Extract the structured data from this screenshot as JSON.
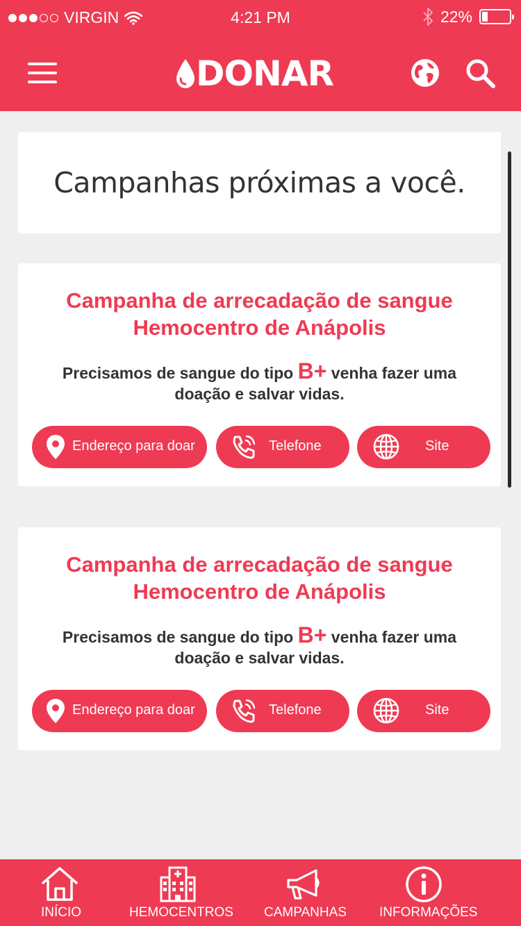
{
  "status_bar": {
    "carrier": "VIRGIN",
    "signal_bars": 3,
    "time": "4:21 PM",
    "battery_text": "22%",
    "battery_level": 0.22,
    "icons": [
      "signal-dots-icon",
      "wifi-icon",
      "bluetooth-icon",
      "battery-icon"
    ]
  },
  "navbar": {
    "logo_text": "DONAR",
    "icons": [
      "menu-icon",
      "blood-drop-icon",
      "globe-icon",
      "search-icon"
    ]
  },
  "header": {
    "title": "Campanhas próximas a você."
  },
  "campaigns": [
    {
      "title_line1": "Campanha de arrecadação de sangue",
      "title_line2": "Hemocentro de Anápolis",
      "desc_before": "Precisamos  de sangue do tipo ",
      "blood_type": "B+",
      "desc_after": " venha fazer uma",
      "desc_line2": "doação e salvar vidas.",
      "buttons": {
        "address": "Endereço para doar",
        "phone": "Telefone",
        "site": "Site"
      }
    },
    {
      "title_line1": "Campanha de arrecadação de sangue",
      "title_line2": "Hemocentro de Anápolis",
      "desc_before": "Precisamos  de sangue do tipo ",
      "blood_type": "B+",
      "desc_after": " venha fazer uma",
      "desc_line2": "doação e salvar vidas.",
      "buttons": {
        "address": "Endereço para doar",
        "phone": "Telefone",
        "site": "Site"
      }
    }
  ],
  "tabbar": {
    "tabs": [
      {
        "label": "INÍCIO",
        "icon": "home-icon"
      },
      {
        "label": "HEMOCENTROS",
        "icon": "hospital-icon"
      },
      {
        "label": "CAMPANHAS",
        "icon": "megaphone-icon"
      },
      {
        "label": "INFORMAÇÕES",
        "icon": "info-icon"
      }
    ]
  },
  "colors": {
    "brand": "#ef3a53",
    "background": "#efefef",
    "card": "#ffffff",
    "text": "#333333"
  }
}
